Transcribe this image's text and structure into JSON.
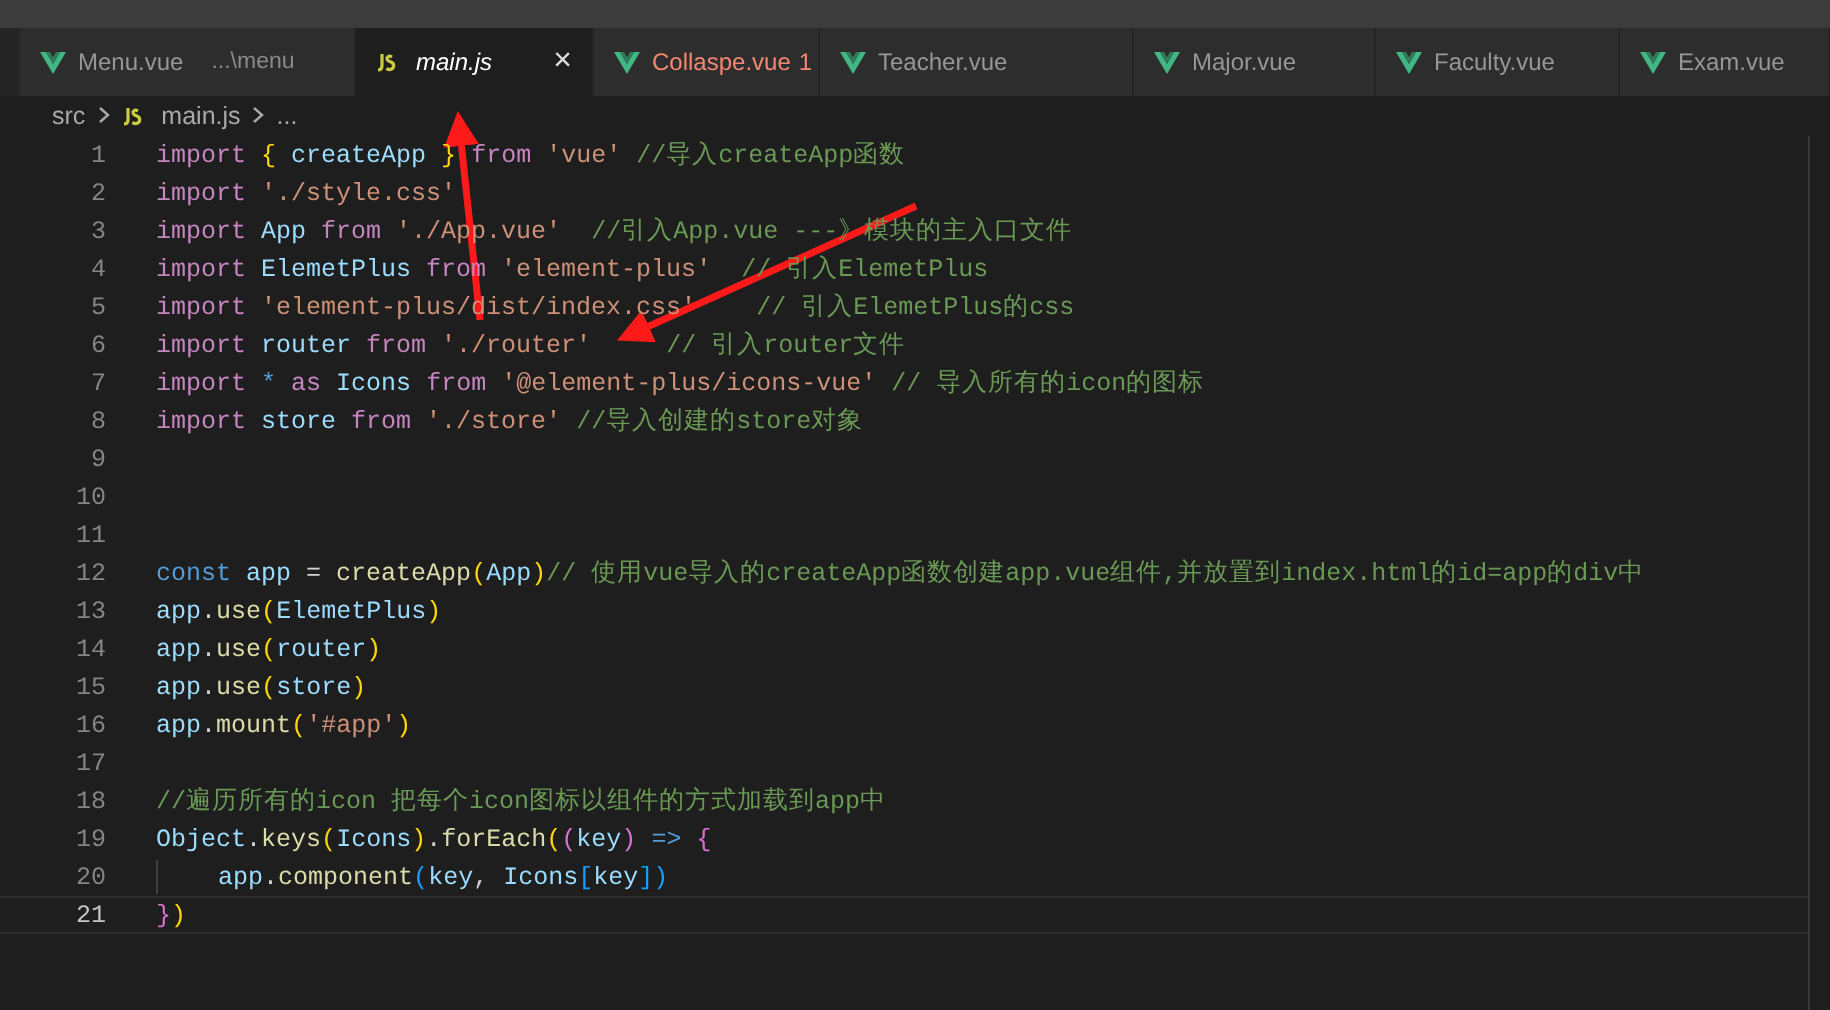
{
  "tabs": [
    {
      "kind": "vue",
      "label": "Menu.vue",
      "detail": "...\\menu",
      "selected": false,
      "preview": false,
      "error": false
    },
    {
      "kind": "js",
      "label": "main.js",
      "selected": true,
      "preview": true,
      "error": false,
      "close": "×"
    },
    {
      "kind": "vue",
      "label": "Collaspe.vue",
      "problems": "1",
      "selected": false,
      "preview": false,
      "error": true
    },
    {
      "kind": "vue",
      "label": "Teacher.vue",
      "selected": false,
      "preview": false,
      "error": false
    },
    {
      "kind": "vue",
      "label": "Major.vue",
      "selected": false,
      "preview": false,
      "error": false
    },
    {
      "kind": "vue",
      "label": "Faculty.vue",
      "selected": false,
      "preview": false,
      "error": false
    },
    {
      "kind": "vue",
      "label": "Exam.vue",
      "selected": false,
      "preview": false,
      "error": false
    }
  ],
  "breadcrumb": [
    {
      "kind": "folder",
      "text": "src"
    },
    {
      "kind": "file",
      "text": "main.js"
    },
    {
      "kind": "symbol",
      "text": "..."
    }
  ],
  "editor": {
    "lines": [
      {
        "number": "1",
        "current": false,
        "tokens": [
          {
            "kind": "keyword",
            "text": "import "
          },
          {
            "kind": "bracket1",
            "text": "{ "
          },
          {
            "kind": "variable",
            "text": "createApp "
          },
          {
            "kind": "bracket1",
            "text": "} "
          },
          {
            "kind": "keyword",
            "text": "from "
          },
          {
            "kind": "string",
            "text": "'vue' "
          },
          {
            "kind": "comment",
            "text": "//导入createApp函数"
          }
        ]
      },
      {
        "number": "2",
        "current": false,
        "tokens": [
          {
            "kind": "keyword",
            "text": "import "
          },
          {
            "kind": "string",
            "text": "'./style.css'"
          }
        ]
      },
      {
        "number": "3",
        "current": false,
        "tokens": [
          {
            "kind": "keyword",
            "text": "import "
          },
          {
            "kind": "variable",
            "text": "App "
          },
          {
            "kind": "keyword",
            "text": "from "
          },
          {
            "kind": "string",
            "text": "'./App.vue'  "
          },
          {
            "kind": "comment",
            "text": "//引入App.vue ---》模块的主入口文件"
          }
        ]
      },
      {
        "number": "4",
        "current": false,
        "tokens": [
          {
            "kind": "keyword",
            "text": "import "
          },
          {
            "kind": "variable",
            "text": "ElemetPlus "
          },
          {
            "kind": "keyword",
            "text": "from "
          },
          {
            "kind": "string",
            "text": "'element-plus'  "
          },
          {
            "kind": "comment",
            "text": "// 引入ElemetPlus"
          }
        ]
      },
      {
        "number": "5",
        "current": false,
        "tokens": [
          {
            "kind": "keyword",
            "text": "import "
          },
          {
            "kind": "string",
            "text": "'element-plus/dist/index.css'    "
          },
          {
            "kind": "comment",
            "text": "// 引入ElemetPlus的css"
          }
        ]
      },
      {
        "number": "6",
        "current": false,
        "tokens": [
          {
            "kind": "keyword",
            "text": "import "
          },
          {
            "kind": "variable",
            "text": "router "
          },
          {
            "kind": "keyword",
            "text": "from "
          },
          {
            "kind": "string",
            "text": "'./router'     "
          },
          {
            "kind": "comment",
            "text": "// 引入router文件"
          }
        ]
      },
      {
        "number": "7",
        "current": false,
        "tokens": [
          {
            "kind": "keyword",
            "text": "import "
          },
          {
            "kind": "storage",
            "text": "* "
          },
          {
            "kind": "keyword",
            "text": "as "
          },
          {
            "kind": "variable",
            "text": "Icons "
          },
          {
            "kind": "keyword",
            "text": "from "
          },
          {
            "kind": "string",
            "text": "'@element-plus/icons-vue' "
          },
          {
            "kind": "comment",
            "text": "// 导入所有的icon的图标"
          }
        ]
      },
      {
        "number": "8",
        "current": false,
        "tokens": [
          {
            "kind": "keyword",
            "text": "import "
          },
          {
            "kind": "variable",
            "text": "store "
          },
          {
            "kind": "keyword",
            "text": "from "
          },
          {
            "kind": "string",
            "text": "'./store' "
          },
          {
            "kind": "comment",
            "text": "//导入创建的store对象"
          }
        ]
      },
      {
        "number": "9",
        "current": false
      },
      {
        "number": "10",
        "current": false
      },
      {
        "number": "11",
        "current": false
      },
      {
        "number": "12",
        "current": false,
        "tokens": [
          {
            "kind": "storage",
            "text": "const "
          },
          {
            "kind": "variable",
            "text": "app "
          },
          {
            "kind": "plain",
            "text": "= "
          },
          {
            "kind": "function",
            "text": "createApp"
          },
          {
            "kind": "bracket1",
            "text": "("
          },
          {
            "kind": "variable",
            "text": "App"
          },
          {
            "kind": "bracket1",
            "text": ")"
          },
          {
            "kind": "comment",
            "text": "// 使用vue导入的createApp函数创建app.vue组件,并放置到index.html的id=app的div中"
          }
        ]
      },
      {
        "number": "13",
        "current": false,
        "tokens": [
          {
            "kind": "variable",
            "text": "app"
          },
          {
            "kind": "plain",
            "text": "."
          },
          {
            "kind": "function",
            "text": "use"
          },
          {
            "kind": "bracket1",
            "text": "("
          },
          {
            "kind": "variable",
            "text": "ElemetPlus"
          },
          {
            "kind": "bracket1",
            "text": ")"
          }
        ]
      },
      {
        "number": "14",
        "current": false,
        "tokens": [
          {
            "kind": "variable",
            "text": "app"
          },
          {
            "kind": "plain",
            "text": "."
          },
          {
            "kind": "function",
            "text": "use"
          },
          {
            "kind": "bracket1",
            "text": "("
          },
          {
            "kind": "variable",
            "text": "router"
          },
          {
            "kind": "bracket1",
            "text": ")"
          }
        ]
      },
      {
        "number": "15",
        "current": false,
        "tokens": [
          {
            "kind": "variable",
            "text": "app"
          },
          {
            "kind": "plain",
            "text": "."
          },
          {
            "kind": "function",
            "text": "use"
          },
          {
            "kind": "bracket1",
            "text": "("
          },
          {
            "kind": "variable",
            "text": "store"
          },
          {
            "kind": "bracket1",
            "text": ")"
          }
        ]
      },
      {
        "number": "16",
        "current": false,
        "tokens": [
          {
            "kind": "variable",
            "text": "app"
          },
          {
            "kind": "plain",
            "text": "."
          },
          {
            "kind": "function",
            "text": "mount"
          },
          {
            "kind": "bracket1",
            "text": "("
          },
          {
            "kind": "string",
            "text": "'#app'"
          },
          {
            "kind": "bracket1",
            "text": ")"
          }
        ]
      },
      {
        "number": "17",
        "current": false
      },
      {
        "number": "18",
        "current": false,
        "tokens": [
          {
            "kind": "comment",
            "text": "//遍历所有的icon 把每个icon图标以组件的方式加载到app中"
          }
        ]
      },
      {
        "number": "19",
        "current": false,
        "tokens": [
          {
            "kind": "variable",
            "text": "Object"
          },
          {
            "kind": "plain",
            "text": "."
          },
          {
            "kind": "function",
            "text": "keys"
          },
          {
            "kind": "bracket1",
            "text": "("
          },
          {
            "kind": "variable",
            "text": "Icons"
          },
          {
            "kind": "bracket1",
            "text": ")"
          },
          {
            "kind": "plain",
            "text": "."
          },
          {
            "kind": "function",
            "text": "forEach"
          },
          {
            "kind": "bracket1",
            "text": "("
          },
          {
            "kind": "bracket2",
            "text": "("
          },
          {
            "kind": "variable",
            "text": "key"
          },
          {
            "kind": "bracket2",
            "text": ") "
          },
          {
            "kind": "storage",
            "text": "=> "
          },
          {
            "kind": "bracket2",
            "text": "{"
          }
        ]
      },
      {
        "number": "20",
        "current": false,
        "indent": true,
        "tokens": [
          {
            "kind": "variable",
            "text": "app"
          },
          {
            "kind": "plain",
            "text": "."
          },
          {
            "kind": "function",
            "text": "component"
          },
          {
            "kind": "bracket3",
            "text": "("
          },
          {
            "kind": "variable",
            "text": "key"
          },
          {
            "kind": "plain",
            "text": ", "
          },
          {
            "kind": "variable",
            "text": "Icons"
          },
          {
            "kind": "bracket3",
            "text": "["
          },
          {
            "kind": "variable",
            "text": "key"
          },
          {
            "kind": "bracket3",
            "text": "])"
          }
        ]
      },
      {
        "number": "21",
        "current": true,
        "tokens": [
          {
            "kind": "bracket2",
            "text": "}"
          },
          {
            "kind": "bracket1",
            "text": ")"
          }
        ]
      }
    ]
  }
}
